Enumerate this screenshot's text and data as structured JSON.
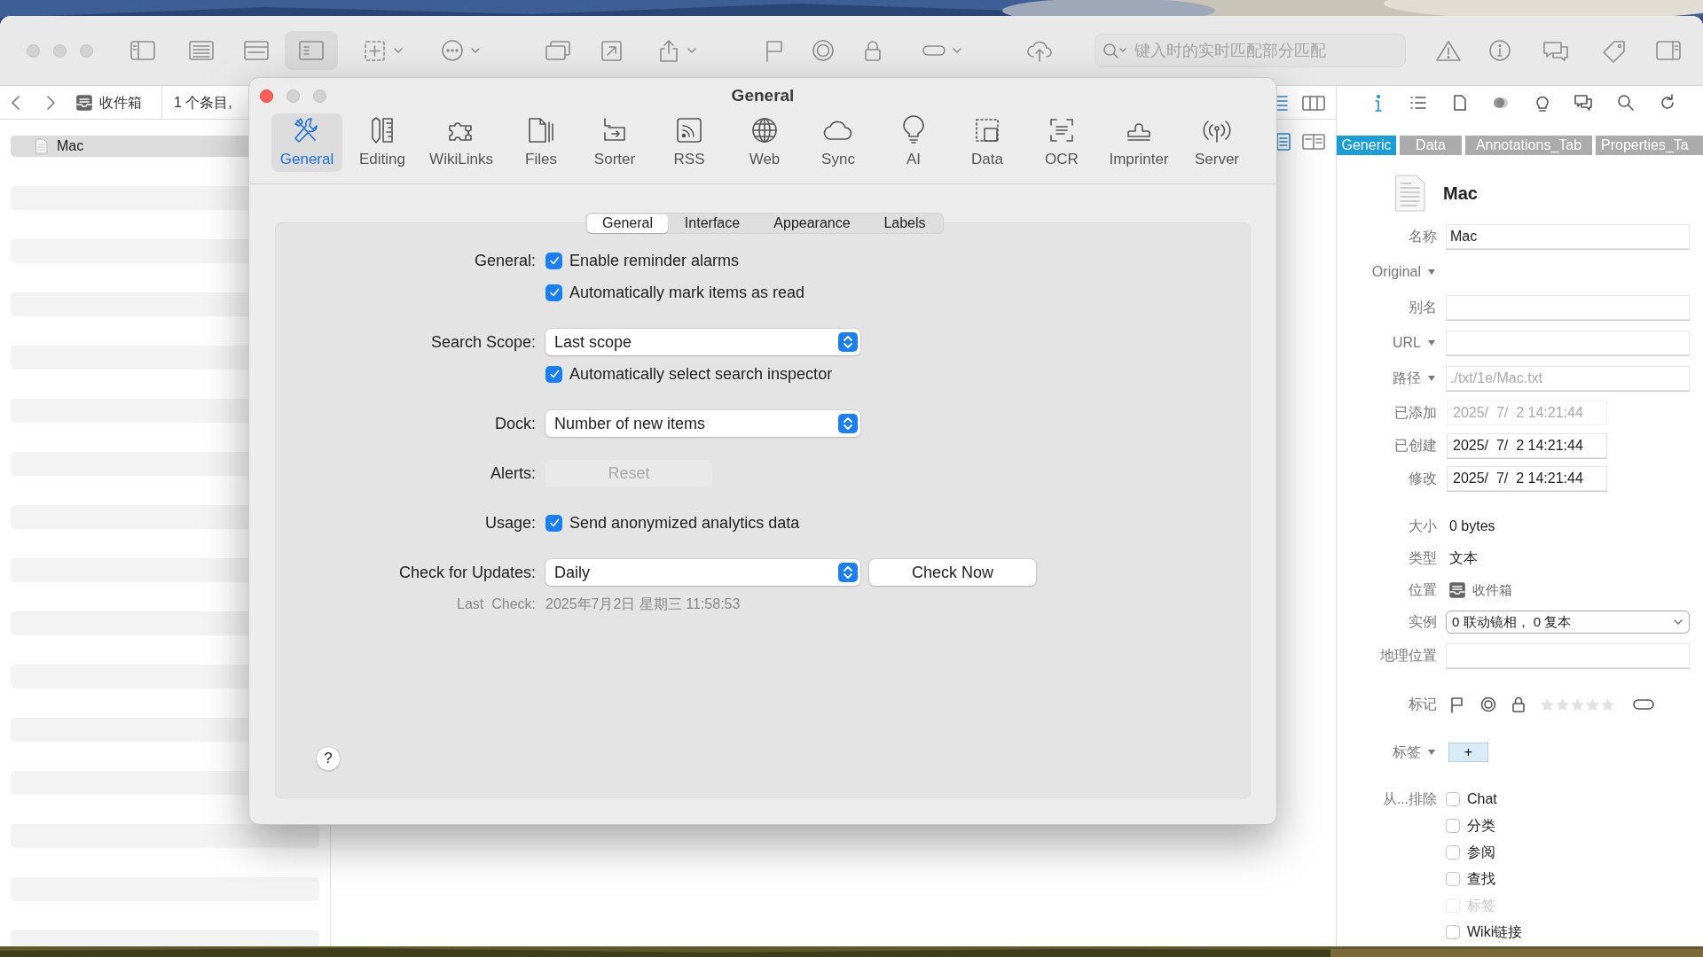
{
  "app_window": {
    "toolbar": {
      "buttons": [
        {
          "selected": false,
          "menu": false
        },
        {
          "selected": false,
          "menu": false
        },
        {
          "selected": false,
          "menu": false
        },
        {
          "selected": true,
          "menu": false
        },
        {
          "selected": false,
          "menu": true
        },
        {
          "selected": false,
          "menu": true
        },
        {
          "selected": false,
          "menu": false
        },
        {
          "selected": false,
          "menu": false
        },
        {
          "selected": false,
          "menu": true
        },
        {
          "selected": false,
          "menu": false
        },
        {
          "selected": false,
          "menu": false
        },
        {
          "selected": false,
          "menu": false
        },
        {
          "selected": false,
          "menu": true
        },
        {
          "selected": false,
          "menu": false
        },
        {
          "selected": false,
          "menu": false
        },
        {
          "selected": false,
          "menu": false
        },
        {
          "selected": false,
          "menu": false
        },
        {
          "selected": false,
          "menu": false
        },
        {
          "selected": false,
          "menu": false
        }
      ],
      "search": {
        "placeholder": "键入时的实时匹配部分匹配"
      }
    },
    "path_bar": {
      "location": "收件箱",
      "count": "1 个条目,"
    },
    "view_buttons": [
      {
        "selected": true
      },
      {
        "selected": false
      }
    ],
    "sidebar": {
      "items": [
        {
          "label": "Mac",
          "selected": true
        }
      ]
    },
    "inspector": {
      "tool_buttons": [
        {
          "selected": true
        },
        {
          "selected": false
        },
        {
          "selected": false
        },
        {
          "selected": false
        },
        {
          "selected": false
        },
        {
          "selected": false
        },
        {
          "selected": false
        },
        {
          "selected": false
        }
      ],
      "tabs": [
        {
          "label": "Generic",
          "selected": true
        },
        {
          "label": "Data",
          "selected": false
        },
        {
          "label": "Annotations_Tab",
          "selected": false
        },
        {
          "label": "Properties_Ta",
          "selected": false
        }
      ],
      "title": "Mac",
      "field_groups": [
        [
          {
            "kind": "field",
            "label": "名称",
            "value": "Mac",
            "dim": false,
            "menu": false
          },
          {
            "kind": "menu-label",
            "label": "Original",
            "menu": true
          },
          {
            "kind": "field",
            "label": "别名",
            "menu": false
          },
          {
            "kind": "field",
            "label": "URL",
            "menu": true
          },
          {
            "kind": "field",
            "label": "路径",
            "value": "./txt/1e/Mac.txt",
            "dim": true,
            "menu": true
          },
          {
            "kind": "date",
            "label": "已添加",
            "value": "2025/  7/  2 14:21:44",
            "dim": true,
            "menu": false
          },
          {
            "kind": "date",
            "label": "已创建",
            "value": "2025/  7/  2 14:21:44",
            "dim": false,
            "menu": false
          },
          {
            "kind": "date",
            "label": "修改",
            "value": "2025/  7/  2 14:21:44",
            "dim": false,
            "menu": false
          }
        ],
        [
          {
            "kind": "text",
            "label": "大小",
            "value": "0 bytes",
            "menu": false
          },
          {
            "kind": "text",
            "label": "类型",
            "value": "文本",
            "menu": false
          },
          {
            "kind": "location",
            "label": "位置",
            "value": "收件箱",
            "menu": false
          },
          {
            "kind": "select",
            "label": "实例",
            "value": "0 联动镜相， 0 复本",
            "menu": false
          },
          {
            "kind": "field",
            "label": "地理位置",
            "menu": false
          }
        ]
      ],
      "marks": {
        "label": "标记",
        "stars": 0
      },
      "tags": {
        "label": "标签",
        "add": "+"
      },
      "exclude": {
        "label": "从...排除",
        "options": [
          {
            "label": "Chat",
            "checked": false,
            "disabled": false
          },
          {
            "label": "分类",
            "checked": false,
            "disabled": false
          },
          {
            "label": "参阅",
            "checked": false,
            "disabled": false
          },
          {
            "label": "查找",
            "checked": false,
            "disabled": false
          },
          {
            "label": "标签",
            "checked": false,
            "disabled": true
          },
          {
            "label": "Wiki链接",
            "checked": false,
            "disabled": false
          }
        ]
      }
    }
  },
  "preferences_dialog": {
    "title": "General",
    "toolbar": [
      {
        "label": "General",
        "selected": true
      },
      {
        "label": "Editing",
        "selected": false
      },
      {
        "label": "WikiLinks",
        "selected": false
      },
      {
        "label": "Files",
        "selected": false
      },
      {
        "label": "Sorter",
        "selected": false
      },
      {
        "label": "RSS",
        "selected": false
      },
      {
        "label": "Web",
        "selected": false
      },
      {
        "label": "Sync",
        "selected": false
      },
      {
        "label": "AI",
        "selected": false
      },
      {
        "label": "Data",
        "selected": false
      },
      {
        "label": "OCR",
        "selected": false
      },
      {
        "label": "Imprinter",
        "selected": false
      },
      {
        "label": "Server",
        "selected": false
      }
    ],
    "tabs": [
      {
        "label": "General",
        "selected": true
      },
      {
        "label": "Interface",
        "selected": false
      },
      {
        "label": "Appearance",
        "selected": false
      },
      {
        "label": "Labels",
        "selected": false
      }
    ],
    "groups": [
      [
        {
          "kind": "checkbox",
          "label": "General:",
          "text": "Enable reminder alarms",
          "checked": true
        },
        {
          "kind": "checkbox",
          "text": "Automatically mark items as read",
          "checked": true
        }
      ],
      [
        {
          "kind": "popup",
          "label": "Search Scope:",
          "value": "Last scope"
        },
        {
          "kind": "checkbox",
          "text": "Automatically select search inspector",
          "checked": true
        }
      ],
      [
        {
          "kind": "popup",
          "label": "Dock:",
          "value": "Number of new items"
        }
      ],
      [
        {
          "kind": "button",
          "label": "Alerts:",
          "text": "Reset",
          "disabled": true
        }
      ],
      [
        {
          "kind": "checkbox",
          "label": "Usage:",
          "text": "Send anonymized analytics data",
          "checked": true
        }
      ],
      [
        {
          "kind": "popup",
          "label": "Check for Updates:",
          "value": "Daily",
          "button": "Check Now"
        },
        {
          "kind": "info",
          "label": "Last  Check:",
          "text": "2025年7月2日 星期三 11:58:53"
        }
      ]
    ],
    "help": "?"
  }
}
